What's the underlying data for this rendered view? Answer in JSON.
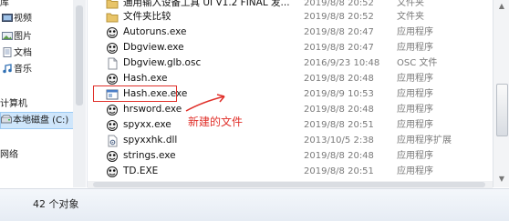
{
  "nav": {
    "items": [
      {
        "label": "库",
        "icon": "library-icon"
      },
      {
        "label": "视频",
        "icon": "video-library-icon"
      },
      {
        "label": "图片",
        "icon": "pictures-library-icon"
      },
      {
        "label": "文档",
        "icon": "documents-library-icon"
      },
      {
        "label": "音乐",
        "icon": "music-library-icon"
      },
      {
        "label": "计算机",
        "icon": "computer-icon"
      },
      {
        "label": "本地磁盘 (C:)",
        "icon": "local-disk-icon"
      },
      {
        "label": "网络",
        "icon": "network-icon"
      }
    ]
  },
  "files": [
    {
      "name": "通用输入设备工具 UI V1.2 FINAL 发...",
      "date": "2019/8/8 20:52",
      "type": "文件夹",
      "icon": "folder-icon"
    },
    {
      "name": "文件夹比较",
      "date": "2019/8/8 20:52",
      "type": "文件夹",
      "icon": "folder-icon"
    },
    {
      "name": "Autoruns.exe",
      "date": "2019/8/8 20:47",
      "type": "应用程序",
      "icon": "exe-icon"
    },
    {
      "name": "Dbgview.exe",
      "date": "2019/8/8 20:47",
      "type": "应用程序",
      "icon": "exe-icon"
    },
    {
      "name": "Dbgview.glb.osc",
      "date": "2016/9/23 10:48",
      "type": "OSC 文件",
      "icon": "file-icon"
    },
    {
      "name": "Hash.exe",
      "date": "2019/8/8 20:48",
      "type": "应用程序",
      "icon": "exe-icon"
    },
    {
      "name": "Hash.exe.exe",
      "date": "2019/8/9 10:53",
      "type": "应用程序",
      "icon": "app-window-icon"
    },
    {
      "name": "hrsword.exe",
      "date": "2019/8/8 20:48",
      "type": "应用程序",
      "icon": "exe-icon"
    },
    {
      "name": "spyxx.exe",
      "date": "2019/8/8 20:51",
      "type": "应用程序",
      "icon": "exe-icon"
    },
    {
      "name": "spyxxhk.dll",
      "date": "2013/10/5 2:38",
      "type": "应用程序扩展",
      "icon": "dll-icon"
    },
    {
      "name": "strings.exe",
      "date": "2019/8/8 20:48",
      "type": "应用程序",
      "icon": "exe-icon"
    },
    {
      "name": "TD.EXE",
      "date": "2019/8/8 20:51",
      "type": "应用程序",
      "icon": "exe-icon"
    }
  ],
  "annotation": {
    "label": "新建的文件",
    "color": "#e0302a"
  },
  "status": {
    "count_label": "42 个对象"
  },
  "colors": {
    "selection": "#cfe6fb",
    "annotation": "#e0302a",
    "folder": "#e8c468"
  }
}
